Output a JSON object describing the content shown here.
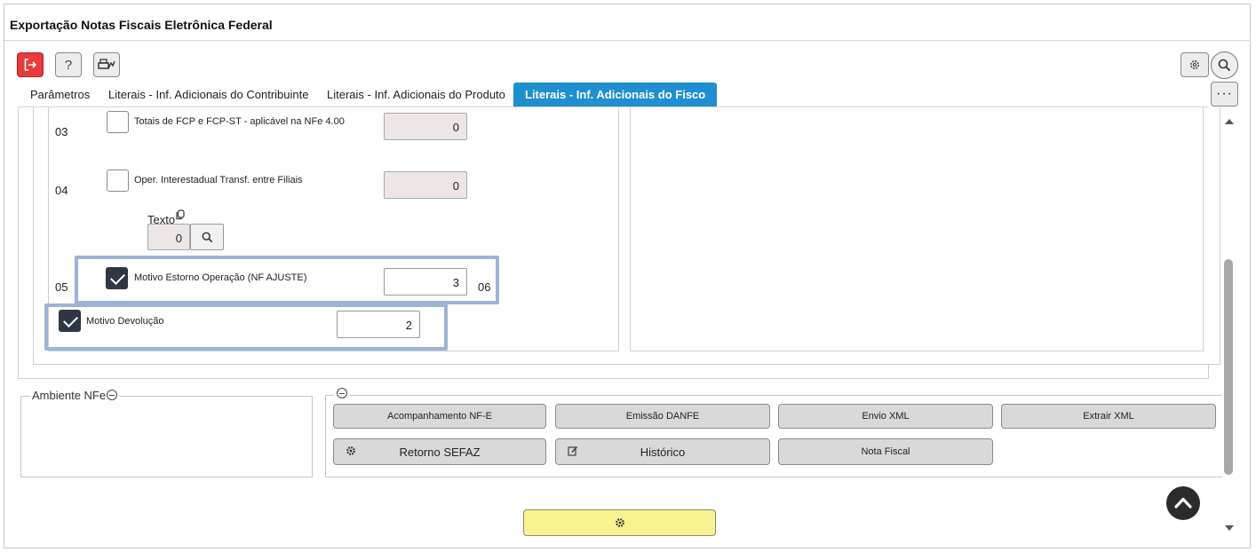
{
  "window": {
    "title": "Exportação Notas Fiscais Eletrônica Federal"
  },
  "toolbar": {
    "exit_icon": "exit-icon",
    "help_label": "?",
    "print_icon": "print-icon",
    "settings_icon": "gear-icon",
    "search_icon": "search-icon",
    "more_icon": "ellipsis-icon"
  },
  "tabs": [
    {
      "label": "Parâmetros"
    },
    {
      "label": "Literais - Inf. Adicionais do Contribuinte"
    },
    {
      "label": "Literais - Inf. Adicionais do Produto"
    },
    {
      "label": "Literais - Inf. Adicionais do Fisco",
      "active": true
    }
  ],
  "rows": [
    {
      "num": "03",
      "label": "Totais de FCP e FCP-ST - aplicável na NFe 4.00",
      "checked": false,
      "value": "0"
    },
    {
      "num": "04",
      "label": "Oper. Interestadual Transf. entre Filiais",
      "checked": false,
      "value": "0"
    },
    {
      "num": "05",
      "label": "Motivo Estorno Operação (NF AJUSTE)",
      "checked": true,
      "value": "3"
    },
    {
      "num": "06",
      "label": "Motivo Devolução",
      "checked": true,
      "value": "2"
    }
  ],
  "texto": {
    "label": "Texto",
    "value": "0"
  },
  "ambiente": {
    "legend": "Ambiente NFe"
  },
  "actions": [
    {
      "label": "Acompanhamento NF-E"
    },
    {
      "label": "Emissão DANFE"
    },
    {
      "label": "Envio XML"
    },
    {
      "label": "Extrair XML"
    },
    {
      "label": "Retorno SEFAZ",
      "icon": "gear-icon"
    },
    {
      "label": "Histórico",
      "icon": "edit-icon"
    },
    {
      "label": "Nota Fiscal"
    }
  ],
  "colors": {
    "active_tab": "#1f8fcf",
    "exit_button": "#e83a3a",
    "highlight": "#9bb5d6",
    "process_button": "#f7f390"
  }
}
